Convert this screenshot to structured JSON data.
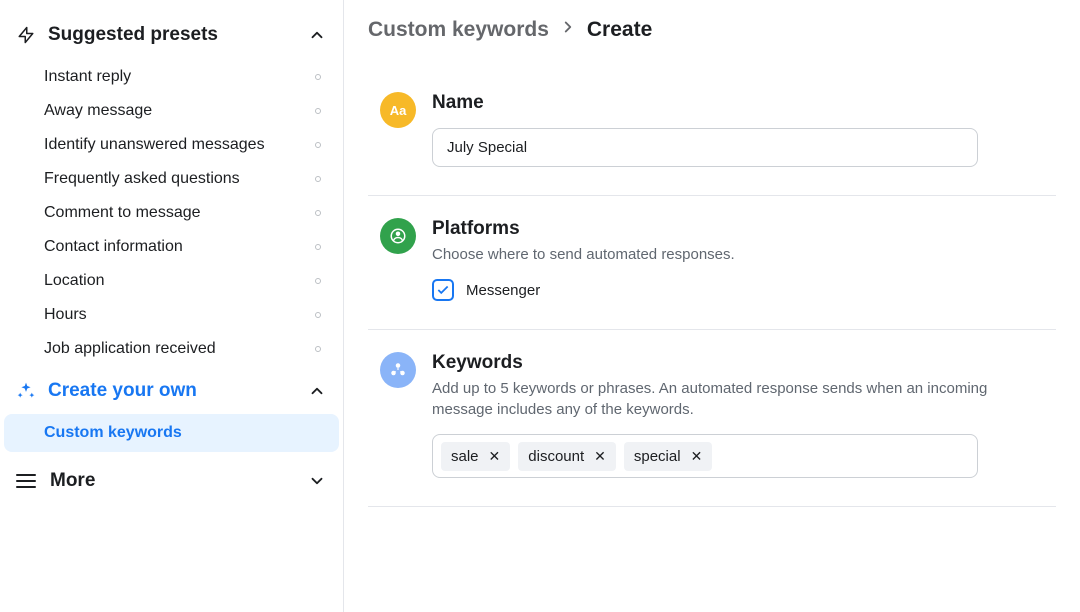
{
  "sidebar": {
    "sections": {
      "suggested": {
        "title": "Suggested presets",
        "expanded": true,
        "items": [
          {
            "label": "Instant reply"
          },
          {
            "label": "Away message"
          },
          {
            "label": "Identify unanswered messages"
          },
          {
            "label": "Frequently asked questions"
          },
          {
            "label": "Comment to message"
          },
          {
            "label": "Contact information"
          },
          {
            "label": "Location"
          },
          {
            "label": "Hours"
          },
          {
            "label": "Job application received"
          }
        ]
      },
      "create_own": {
        "title": "Create your own",
        "expanded": true,
        "items": [
          {
            "label": "Custom keywords",
            "active": true
          }
        ]
      },
      "more": {
        "title": "More",
        "expanded": false
      }
    }
  },
  "breadcrumb": {
    "parent": "Custom keywords",
    "current": "Create"
  },
  "form": {
    "name": {
      "title": "Name",
      "value": "July Special"
    },
    "platforms": {
      "title": "Platforms",
      "desc": "Choose where to send automated responses.",
      "options": [
        {
          "label": "Messenger",
          "checked": true
        }
      ]
    },
    "keywords": {
      "title": "Keywords",
      "desc": "Add up to 5 keywords or phrases. An automated response sends when an incoming message includes any of the keywords.",
      "chips": [
        "sale",
        "discount",
        "special"
      ]
    }
  }
}
